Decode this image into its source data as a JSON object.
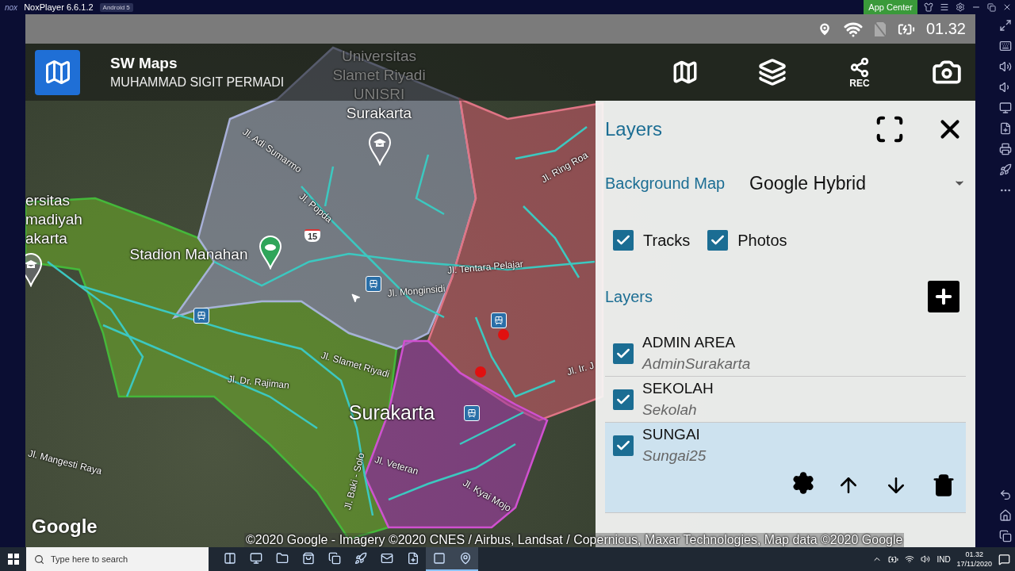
{
  "emulator": {
    "logo": "nox",
    "name": "NoxPlayer 6.6.1.2",
    "badge": "Android 5",
    "app_center": "App Center"
  },
  "status_bar": {
    "time": "01.32"
  },
  "app_bar": {
    "title": "SW Maps",
    "subtitle": "MUHAMMAD SIGIT PERMADI",
    "rec_label": "REC"
  },
  "map": {
    "labels": [
      {
        "kind": "place",
        "lines": [
          "Universitas",
          "Slamet Riyadi",
          "UNISRI",
          "Surakarta"
        ]
      },
      {
        "kind": "place",
        "lines": [
          "ersitas",
          "madiyah",
          "akarta"
        ]
      },
      {
        "kind": "place",
        "lines": [
          "Stadion Manahan"
        ]
      },
      {
        "kind": "road",
        "lines": [
          "Jl. Adi Sumarmo"
        ]
      },
      {
        "kind": "road",
        "lines": [
          "Jl. Popda"
        ]
      },
      {
        "kind": "road",
        "lines": [
          "Jl. Ring Roa"
        ]
      },
      {
        "kind": "road",
        "lines": [
          "Jl. Tentara Pelajar"
        ]
      },
      {
        "kind": "road",
        "lines": [
          "Jl. Monginsidi"
        ]
      },
      {
        "kind": "road",
        "lines": [
          "Jl. Slamet Riyadi"
        ]
      },
      {
        "kind": "road",
        "lines": [
          "Jl. Dr. Rajiman"
        ]
      },
      {
        "kind": "road",
        "lines": [
          "Jl. Ir. J"
        ]
      },
      {
        "kind": "city",
        "lines": [
          "Surakarta"
        ]
      },
      {
        "kind": "road",
        "lines": [
          "Jl. Mangesti Raya"
        ]
      },
      {
        "kind": "road",
        "lines": [
          "Jl. Veteran"
        ]
      },
      {
        "kind": "road",
        "lines": [
          "Jl. Baki - Solo"
        ]
      },
      {
        "kind": "road",
        "lines": [
          "Jl. Kyai Mojo"
        ]
      }
    ],
    "route_shield": "15",
    "logo": "Google",
    "attribution": "©2020 Google - Imagery ©2020 CNES / Airbus, Landsat / Copernicus, Maxar Technologies, Map data ©2020 Google"
  },
  "layers_panel": {
    "title": "Layers",
    "background_map": {
      "label": "Background Map",
      "value": "Google Hybrid"
    },
    "toggles": [
      {
        "label": "Tracks",
        "checked": true
      },
      {
        "label": "Photos",
        "checked": true
      }
    ],
    "layers_heading": "Layers",
    "layers": [
      {
        "name": "ADMIN AREA",
        "source": "AdminSurakarta",
        "checked": true,
        "selected": false
      },
      {
        "name": "SEKOLAH",
        "source": "Sekolah",
        "checked": true,
        "selected": false
      },
      {
        "name": "SUNGAI",
        "source": "Sungai25",
        "checked": true,
        "selected": true
      }
    ]
  },
  "taskbar": {
    "search_placeholder": "Type here to search",
    "apps": [
      {
        "kind": "task-view",
        "active": false
      },
      {
        "kind": "browser",
        "active": false
      },
      {
        "kind": "folder",
        "active": false
      },
      {
        "kind": "store",
        "active": false
      },
      {
        "kind": "c-app",
        "active": false
      },
      {
        "kind": "red-app",
        "active": false
      },
      {
        "kind": "mail",
        "active": false
      },
      {
        "kind": "word",
        "active": false
      },
      {
        "kind": "nox",
        "active": true
      },
      {
        "kind": "maps-app",
        "active": true
      }
    ],
    "language": "IND",
    "time": "01.32",
    "date": "17/11/2020"
  }
}
